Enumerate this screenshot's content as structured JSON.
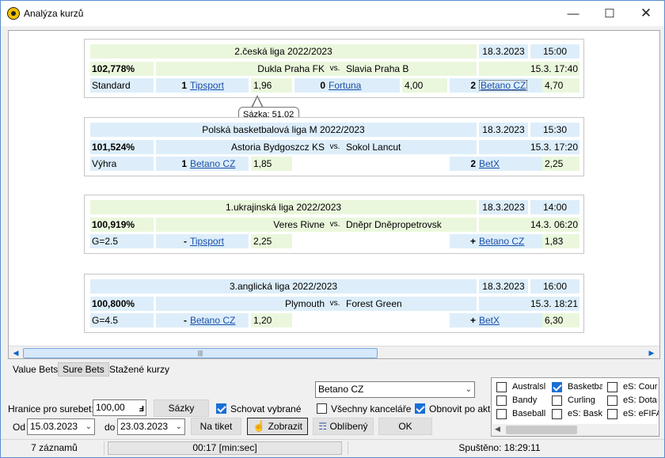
{
  "window": {
    "title": "Analýza kurzů"
  },
  "matches": [
    {
      "league": "2.česká liga 2022/2023",
      "date": "18.3.2023",
      "time": "15:00",
      "percent": "102,778%",
      "home": "Dukla Praha FK",
      "vs": "vs.",
      "away": "Slavia Praha B",
      "start": "15.3. 17:40",
      "bet_type": "Standard",
      "odds": [
        {
          "outcome": "1",
          "bookmaker": "Tipsport",
          "value": "1,96"
        },
        {
          "outcome": "0",
          "bookmaker": "Fortuna",
          "value": "4,00"
        },
        {
          "outcome": "2",
          "bookmaker": "Betano CZ",
          "value": "4,70"
        }
      ]
    },
    {
      "league": "Polská basketbalová liga M 2022/2023",
      "date": "18.3.2023",
      "time": "15:30",
      "percent": "101,524%",
      "home": "Astoria Bydgoszcz KS",
      "vs": "vs.",
      "away": "Sokol Lancut",
      "start": "15.3. 17:20",
      "bet_type": "Výhra",
      "odds": [
        {
          "outcome": "1",
          "bookmaker": "Betano CZ",
          "value": "1,85"
        },
        {
          "outcome": "2",
          "bookmaker": "BetX",
          "value": "2,25"
        }
      ]
    },
    {
      "league": "1.ukrajinská liga 2022/2023",
      "date": "18.3.2023",
      "time": "14:00",
      "percent": "100,919%",
      "home": "Veres Rivne",
      "vs": "vs.",
      "away": "Dněpr Dněpropetrovsk",
      "start": "14.3. 06:20",
      "bet_type": "G=2.5",
      "odds": [
        {
          "outcome": "-",
          "bookmaker": "Tipsport",
          "value": "2,25"
        },
        {
          "outcome": "+",
          "bookmaker": "Betano CZ",
          "value": "1,83"
        }
      ]
    },
    {
      "league": "3.anglická liga 2022/2023",
      "date": "18.3.2023",
      "time": "16:00",
      "percent": "100,800%",
      "home": "Plymouth",
      "vs": "vs.",
      "away": "Forest Green",
      "start": "15.3. 18:21",
      "bet_type": "G=4.5",
      "odds": [
        {
          "outcome": "-",
          "bookmaker": "Betano CZ",
          "value": "1,20"
        },
        {
          "outcome": "+",
          "bookmaker": "BetX",
          "value": "6,30"
        }
      ]
    }
  ],
  "tooltip": {
    "text": "Sázka: 51,02"
  },
  "tabs": [
    {
      "label": "Value Bets",
      "active": false
    },
    {
      "label": "Sure Bets",
      "active": true
    },
    {
      "label": "Stažené kurzy",
      "active": false
    }
  ],
  "controls": {
    "threshold_label": "Hranice pro surebet:",
    "threshold_value": "100,00",
    "calc_icon": "calculator-icon",
    "bets_button": "Sázky",
    "hide_selected_label": "Schovat vybrané",
    "hide_selected_checked": true,
    "bookmaker_selected": "Betano CZ",
    "all_bookmakers_label": "Všechny kanceláře",
    "all_bookmakers_checked": false,
    "auto_refresh_label": "Obnovit po akt",
    "auto_refresh_checked": true,
    "from_label": "Od",
    "from_date": "15.03.2023",
    "to_label": "do",
    "to_date": "23.03.2023",
    "ticket_button": "Na tiket",
    "show_button": "Zobrazit",
    "show_icon": "hand-pointer-icon",
    "favorite_button": "Oblíbený",
    "favorite_icon": "book-icon",
    "ok_button": "OK"
  },
  "sports": [
    {
      "label": "Australsl",
      "checked": false
    },
    {
      "label": "Basketba",
      "checked": true
    },
    {
      "label": "eS: Cour",
      "checked": false
    },
    {
      "label": "Bandy",
      "checked": false
    },
    {
      "label": "Curling",
      "checked": false
    },
    {
      "label": "eS: Dota",
      "checked": false
    },
    {
      "label": "Baseball",
      "checked": false
    },
    {
      "label": "eS: Bask",
      "checked": false
    },
    {
      "label": "eS: eFIFA",
      "checked": false
    }
  ],
  "status": {
    "records": "7 záznamů",
    "timer": "00:17  [min:sec]",
    "progress": 0,
    "started": "Spuštěno: 18:29:11"
  },
  "colors": {
    "accent": "#1a6fd6",
    "row_green": "#eaf7dc",
    "row_blue": "#ddeefa",
    "link": "#1a4fa8"
  }
}
